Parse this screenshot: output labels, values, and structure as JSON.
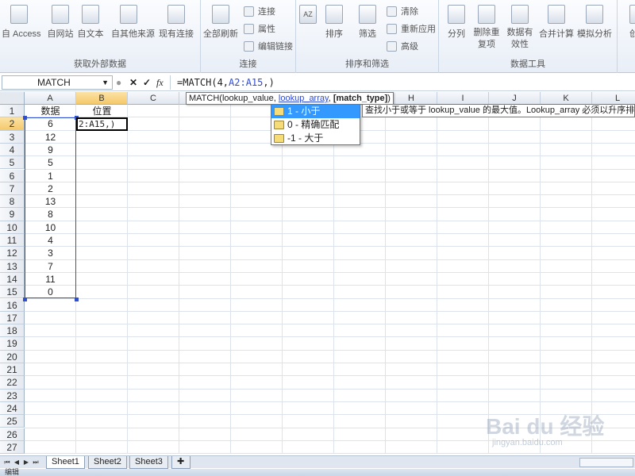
{
  "ribbon": {
    "groups": [
      {
        "label": "获取外部数据",
        "buttons": [
          "自 Access",
          "自网站",
          "自文本",
          "自其他来源",
          "现有连接"
        ]
      },
      {
        "label": "连接",
        "buttons": [
          "全部刷新"
        ],
        "small": [
          "连接",
          "属性",
          "编辑链接"
        ]
      },
      {
        "label": "排序和筛选",
        "buttons": [
          "排序",
          "筛选"
        ],
        "small": [
          "清除",
          "重新应用",
          "高级"
        ],
        "sort_glyph": "AZ"
      },
      {
        "label": "数据工具",
        "buttons": [
          "分列",
          "删除重复项",
          "数据有效性",
          "合并计算",
          "模拟分析"
        ]
      },
      {
        "buttons": [
          "创建"
        ]
      }
    ]
  },
  "formula_bar": {
    "name_box": "MATCH",
    "fx": "fx",
    "formula_prefix": "=MATCH(4,",
    "formula_ref": "A2:A15",
    "formula_suffix": ",)"
  },
  "columns": [
    "A",
    "B",
    "C",
    "D",
    "E",
    "F",
    "G",
    "H",
    "I",
    "J",
    "K",
    "L"
  ],
  "rows": [
    "1",
    "2",
    "3",
    "4",
    "5",
    "6",
    "7",
    "8",
    "9",
    "10",
    "11",
    "12",
    "13",
    "14",
    "15",
    "16",
    "17",
    "18",
    "19",
    "20",
    "21",
    "22",
    "23",
    "24",
    "25",
    "26",
    "27"
  ],
  "cells": {
    "a1": "数据",
    "b1": "位置",
    "column_a_values": [
      "6",
      "12",
      "9",
      "5",
      "1",
      "2",
      "13",
      "8",
      "10",
      "4",
      "3",
      "7",
      "11",
      "0"
    ],
    "b2_editing": "2:A15,)"
  },
  "tooltip": {
    "func": "MATCH(lookup_value, ",
    "arg_current": "lookup_array",
    "sep": ", ",
    "arg_optional": "[match_type]",
    "close": ")"
  },
  "dropdown": {
    "items": [
      "1 - 小于",
      "0 - 精确匹配",
      "-1 - 大于"
    ],
    "selected_index": 0,
    "description": "查找小于或等于 lookup_value 的最大值。Lookup_array 必须以升序排"
  },
  "sheets": [
    "Sheet1",
    "Sheet2",
    "Sheet3"
  ],
  "active_sheet": "Sheet1",
  "status": "编辑",
  "watermark": {
    "main": "Bai du 经验",
    "sub": "jingyan.baidu.com"
  },
  "colors": {
    "selection": "#2d4fd0",
    "header_highlight": "#f5c86a",
    "dropdown_selected": "#3399ff"
  }
}
